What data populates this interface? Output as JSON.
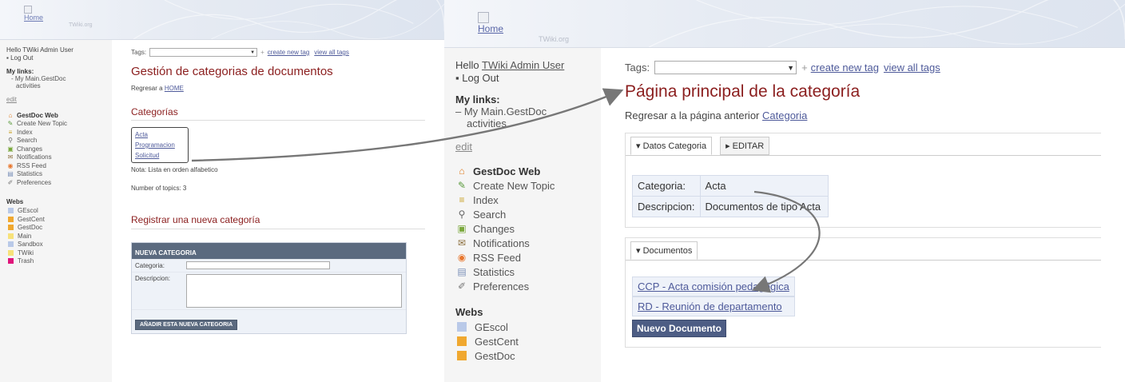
{
  "left": {
    "logo": {
      "home": "Home",
      "twiki": "TWiki.org"
    },
    "sidebar": {
      "hello": "Hello TWiki Admin User",
      "logout": "Log Out",
      "mylinks_title": "My links:",
      "mylinks": [
        "- My Main.GestDoc",
        "activities"
      ],
      "edit": "edit",
      "web_items": [
        {
          "icon": "home-icon",
          "glyph": "⌂",
          "color": "#e07b1f",
          "label": "GestDoc Web"
        },
        {
          "icon": "create-topic-icon",
          "glyph": "✎",
          "color": "#5a9a3c",
          "label": "Create New Topic"
        },
        {
          "icon": "index-icon",
          "glyph": "≡",
          "color": "#c9a227",
          "label": "Index"
        },
        {
          "icon": "search-icon",
          "glyph": "⚲",
          "color": "#666666",
          "label": "Search"
        },
        {
          "icon": "changes-icon",
          "glyph": "▣",
          "color": "#7aa83c",
          "label": "Changes"
        },
        {
          "icon": "notifications-icon",
          "glyph": "✉",
          "color": "#8a6d3b",
          "label": "Notifications"
        },
        {
          "icon": "rss-icon",
          "glyph": "◉",
          "color": "#e8772e",
          "label": "RSS Feed"
        },
        {
          "icon": "statistics-icon",
          "glyph": "▤",
          "color": "#7a8fb8",
          "label": "Statistics"
        },
        {
          "icon": "preferences-icon",
          "glyph": "✐",
          "color": "#777777",
          "label": "Preferences"
        }
      ],
      "webs_title": "Webs",
      "webs": [
        {
          "label": "GEscol",
          "color": "#b9c9e8"
        },
        {
          "label": "GestCent",
          "color": "#f0a830"
        },
        {
          "label": "GestDoc",
          "color": "#f0a830"
        },
        {
          "label": "Main",
          "color": "#f7e27a"
        },
        {
          "label": "Sandbox",
          "color": "#b9c9e8"
        },
        {
          "label": "TWiki",
          "color": "#f7e27a"
        },
        {
          "label": "Trash",
          "color": "#e0147a"
        }
      ]
    },
    "main": {
      "tags_label": "Tags:",
      "create_tag": "create new tag",
      "view_tags": "view all tags",
      "title": "Gestión de categorias de documentos",
      "back_prefix": "Regresar a",
      "back_link": "HOME",
      "categories_heading": "Categorías",
      "categories": [
        "Acta",
        "Programacion",
        "Solicitud"
      ],
      "note": "Nota: Lista en orden alfabetico",
      "count": "Number of topics: 3",
      "register_heading": "Registrar una nueva categoría",
      "form": {
        "header": "NUEVA CATEGORIA",
        "categoria_label": "Categoria:",
        "descripcion_label": "Descripcion:",
        "submit": "AÑADIR ESTA NUEVA CATEGORIA"
      }
    }
  },
  "right": {
    "logo": {
      "home": "Home",
      "twiki": "TWiki.org"
    },
    "sidebar": {
      "hello_prefix": "Hello",
      "hello_user": "TWiki Admin User",
      "logout": "Log Out",
      "mylinks_title": "My links:",
      "mylinks": [
        "– My Main.GestDoc",
        "activities"
      ],
      "edit": "edit",
      "web_items": [
        {
          "icon": "home-icon",
          "glyph": "⌂",
          "color": "#e07b1f",
          "label": "GestDoc Web"
        },
        {
          "icon": "create-topic-icon",
          "glyph": "✎",
          "color": "#5a9a3c",
          "label": "Create New Topic"
        },
        {
          "icon": "index-icon",
          "glyph": "≡",
          "color": "#c9a227",
          "label": "Index"
        },
        {
          "icon": "search-icon",
          "glyph": "⚲",
          "color": "#666666",
          "label": "Search"
        },
        {
          "icon": "changes-icon",
          "glyph": "▣",
          "color": "#7aa83c",
          "label": "Changes"
        },
        {
          "icon": "notifications-icon",
          "glyph": "✉",
          "color": "#8a6d3b",
          "label": "Notifications"
        },
        {
          "icon": "rss-icon",
          "glyph": "◉",
          "color": "#e8772e",
          "label": "RSS Feed"
        },
        {
          "icon": "statistics-icon",
          "glyph": "▤",
          "color": "#7a8fb8",
          "label": "Statistics"
        },
        {
          "icon": "preferences-icon",
          "glyph": "✐",
          "color": "#777777",
          "label": "Preferences"
        }
      ],
      "webs_title": "Webs",
      "webs": [
        {
          "label": "GEscol",
          "color": "#b9c9e8"
        },
        {
          "label": "GestCent",
          "color": "#f0a830"
        },
        {
          "label": "GestDoc",
          "color": "#f0a830"
        }
      ]
    },
    "main": {
      "tags_label": "Tags:",
      "create_tag": "create new tag",
      "view_tags": "view all tags",
      "title": "Página principal de la categoría",
      "back_prefix": "Regresar a la página anterior",
      "back_link": "Categoria",
      "tab_datos": "▾ Datos Categoria",
      "tab_editar": "▸ EDITAR",
      "categoria_label": "Categoria:",
      "categoria_value": "Acta",
      "descripcion_label": "Descripcion:",
      "descripcion_value": "Documentos de tipo Acta",
      "tab_documentos": "▾ Documentos",
      "documents": [
        "CCP - Acta comisión pedagógica",
        "RD - Reunión de departamento"
      ],
      "new_doc": "Nuevo Documento"
    }
  },
  "colors": {
    "title": "#8b1e1e",
    "link": "#4e5a9a",
    "form_header": "#5b6a7f",
    "arrow": "#777777"
  }
}
